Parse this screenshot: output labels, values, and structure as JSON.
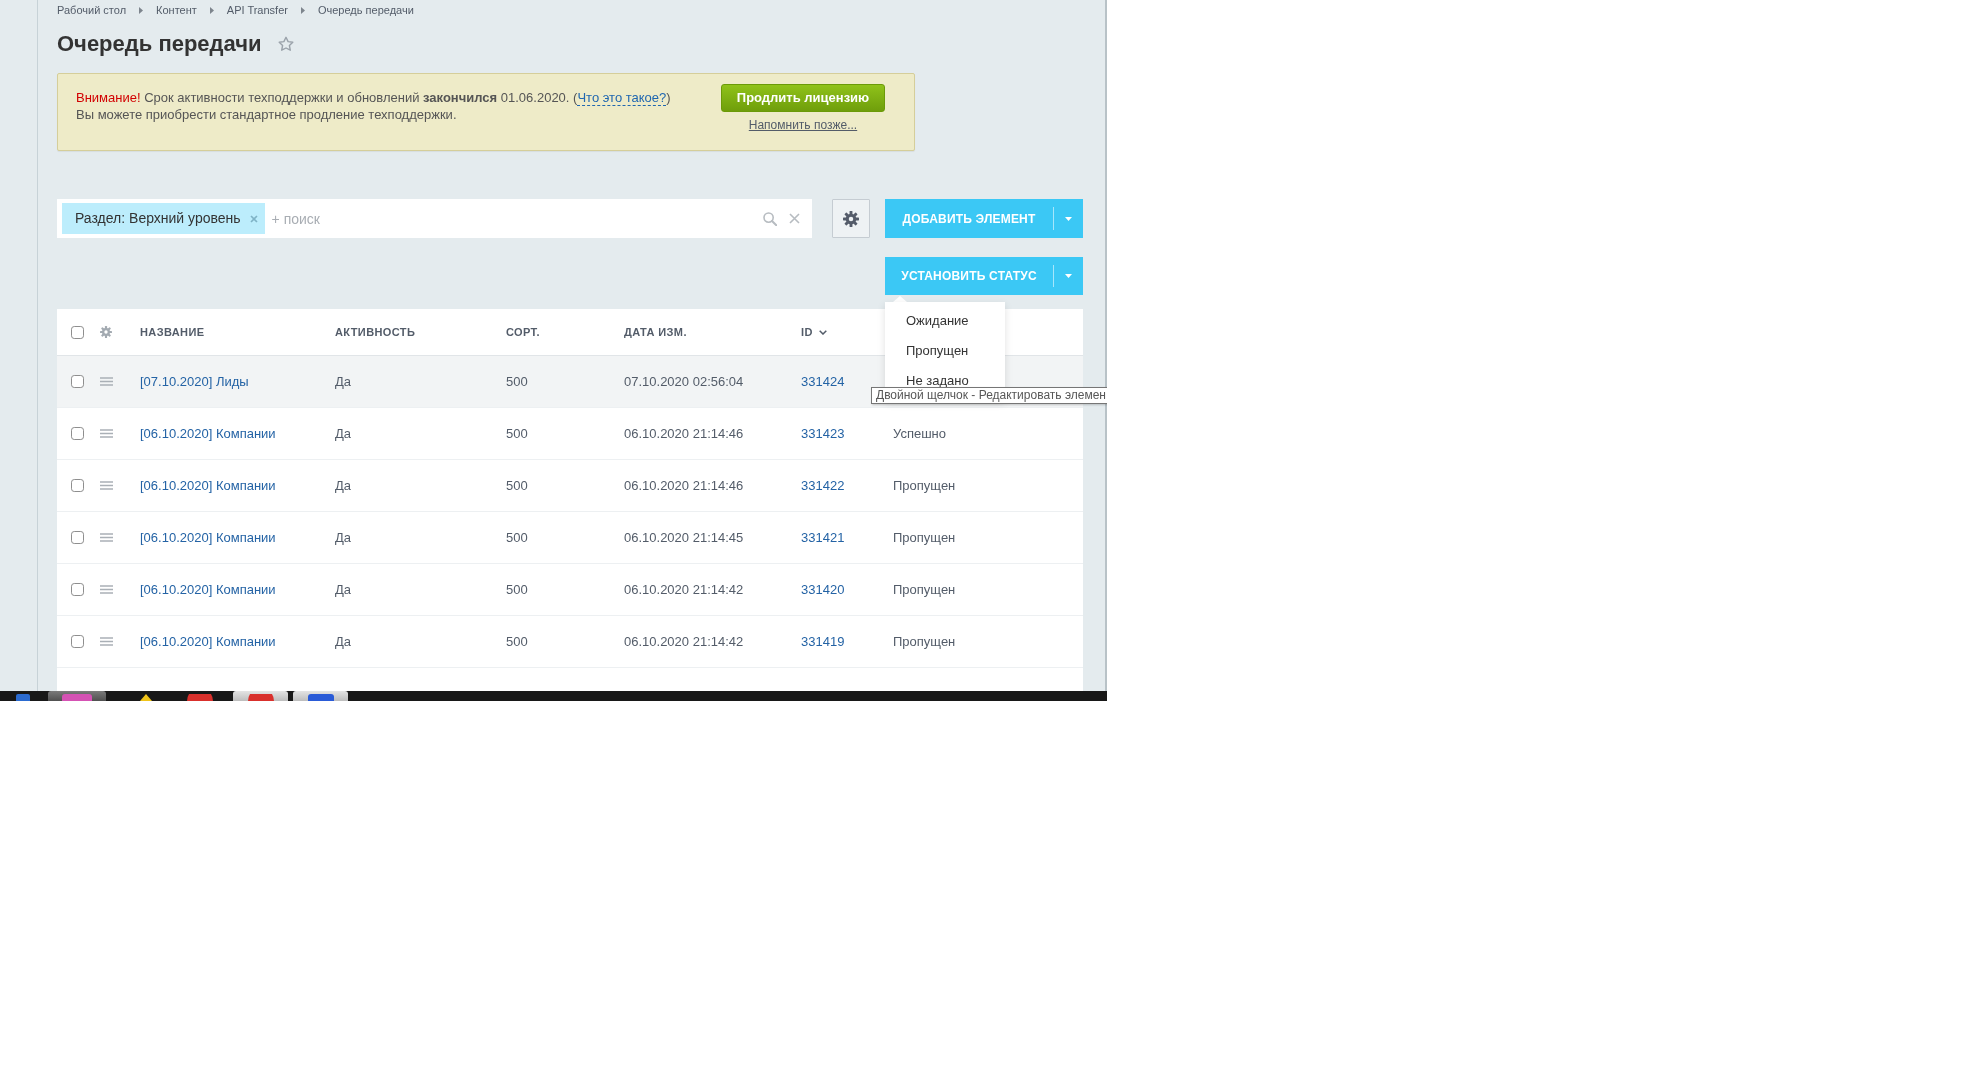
{
  "breadcrumbs": [
    {
      "label": "Рабочий стол"
    },
    {
      "label": "Контент"
    },
    {
      "label": "API Transfer"
    },
    {
      "label": "Очередь передачи"
    }
  ],
  "title": "Очередь передачи",
  "notice": {
    "lines": [
      [
        {
          "kind": "alert",
          "text": "Внимание!"
        },
        {
          "kind": "text",
          "text": " Срок активности техподдержки и обновлений **закончился** 01.06.2020. ("
        },
        {
          "kind": "link",
          "text": "Что это такое?"
        },
        {
          "kind": "text",
          "text": ")"
        }
      ],
      [
        {
          "kind": "text",
          "text": "Вы можете приобрести стандартное продление техподдержки."
        }
      ]
    ],
    "button": "Продлить лицензию",
    "link": "Напомнить позже..."
  },
  "filter": {
    "tags": [
      {
        "label": "Раздел: Верхний уровень"
      }
    ],
    "placeholder": "+ поиск"
  },
  "add_button": {
    "label": "ДОБАВИТЬ ЭЛЕМЕНТ"
  },
  "status_button": {
    "label": "УСТАНОВИТЬ СТАТУС",
    "expanded": true
  },
  "status_menu": {
    "items": [
      {
        "label": "Ожидание"
      },
      {
        "label": "Пропущен"
      },
      {
        "label": "Не задано"
      }
    ]
  },
  "tooltip": {
    "text": "Двойной щелчок - Редактировать элемен"
  },
  "table": {
    "select_all": {
      "checked": false
    },
    "columns": [
      {
        "label": "НАЗВАНИЕ",
        "sorted": false
      },
      {
        "label": "АКТИВНОСТЬ",
        "sorted": false
      },
      {
        "label": "СОРТ.",
        "sorted": false
      },
      {
        "label": "ДАТА ИЗМ.",
        "sorted": false
      },
      {
        "label": "ID",
        "sorted": true
      }
    ],
    "rows": [
      {
        "name": "[07.10.2020] Лиды",
        "active": "Да",
        "sort": "500",
        "modified": "07.10.2020 02:56:04",
        "id": "331424",
        "checked": false,
        "hovered": true
      },
      {
        "name": "[06.10.2020] Компании",
        "active": "Да",
        "sort": "500",
        "modified": "06.10.2020 21:14:46",
        "id": "331423",
        "status": "Успешно",
        "checked": false,
        "hovered": false
      },
      {
        "name": "[06.10.2020] Компании",
        "active": "Да",
        "sort": "500",
        "modified": "06.10.2020 21:14:46",
        "id": "331422",
        "status": "Пропущен",
        "checked": false,
        "hovered": false
      },
      {
        "name": "[06.10.2020] Компании",
        "active": "Да",
        "sort": "500",
        "modified": "06.10.2020 21:14:45",
        "id": "331421",
        "status": "Пропущен",
        "checked": false,
        "hovered": false
      },
      {
        "name": "[06.10.2020] Компании",
        "active": "Да",
        "sort": "500",
        "modified": "06.10.2020 21:14:42",
        "id": "331420",
        "status": "Пропущен",
        "checked": false,
        "hovered": false
      },
      {
        "name": "[06.10.2020] Компании",
        "active": "Да",
        "sort": "500",
        "modified": "06.10.2020 21:14:42",
        "id": "331419",
        "status": "Пропущен",
        "checked": false,
        "hovered": false
      }
    ]
  }
}
